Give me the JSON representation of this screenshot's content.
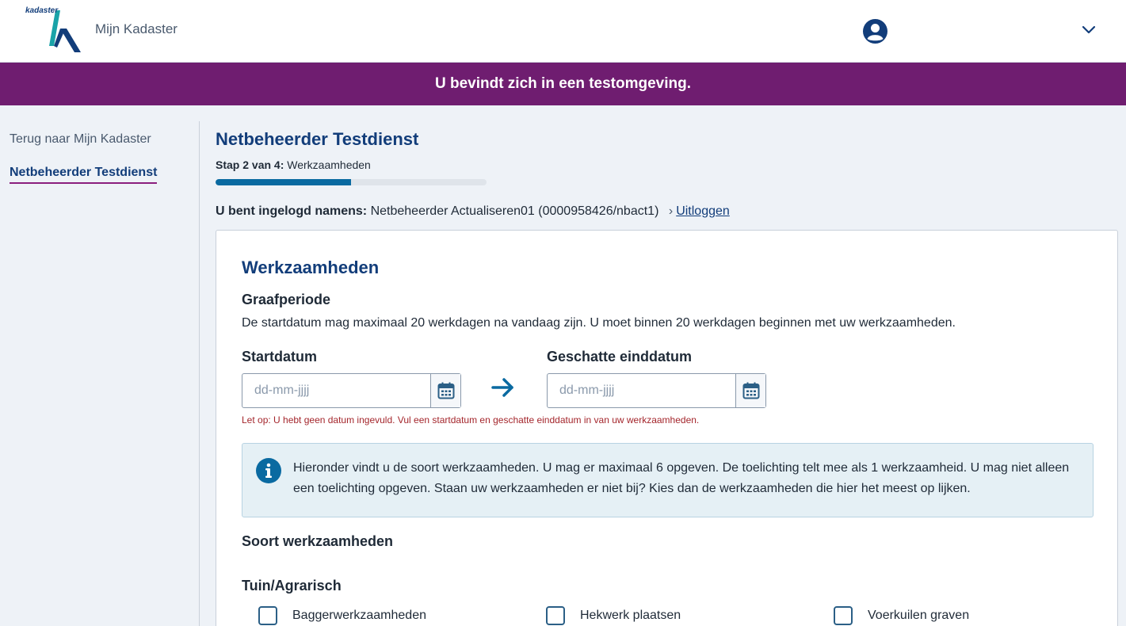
{
  "header": {
    "logo_text": "kadaster",
    "app_name": "Mijn Kadaster"
  },
  "banner": {
    "text": "U bevindt zich in een testomgeving."
  },
  "sidebar": {
    "items": [
      {
        "label": "Terug naar Mijn Kadaster"
      },
      {
        "label": "Netbeheerder Testdienst"
      }
    ]
  },
  "main": {
    "title": "Netbeheerder Testdienst",
    "step_prefix": "Stap 2 van 4:",
    "step_name": "Werkzaamheden",
    "progress_fraction": 0.5,
    "login_label": "U bent ingelogd namens:",
    "login_value": "Netbeheerder Actualiseren01 (0000958426/nbact1)",
    "logout_label": "Uitloggen"
  },
  "card": {
    "title": "Werkzaamheden",
    "graafperiode_heading": "Graafperiode",
    "graafperiode_desc": "De startdatum mag maximaal 20 werkdagen na vandaag zijn. U moet binnen 20 werkdagen beginnen met uw werkzaamheden.",
    "start_label": "Startdatum",
    "start_placeholder": "dd-mm-jjjj",
    "end_label": "Geschatte einddatum",
    "end_placeholder": "dd-mm-jjjj",
    "warning": "Let op: U hebt geen datum ingevuld. Vul een startdatum en geschatte einddatum in van uw werkzaamheden.",
    "info_text": "Hieronder vindt u de soort werkzaamheden. U mag er maximaal 6 opgeven. De toelichting telt mee als 1 werkzaamheid. U mag niet alleen een toelichting opgeven. Staan uw werkzaamheden er niet bij? Kies dan de werkzaamheden die hier het meest op lijken.",
    "soort_heading": "Soort werkzaamheden",
    "category_heading": "Tuin/Agrarisch",
    "checkboxes": [
      {
        "label": "Baggerwerkzaamheden",
        "checked": false
      },
      {
        "label": "Hekwerk plaatsen",
        "checked": false
      },
      {
        "label": "Voerkuilen graven",
        "checked": false
      }
    ]
  },
  "colors": {
    "primary": "#123d7a",
    "banner": "#6f1d70",
    "accent": "#0a6aa1",
    "warning": "#a4262c"
  },
  "icons": [
    "kadaster-logo",
    "user-icon",
    "chevron-down-icon",
    "calendar-icon",
    "arrow-right-icon",
    "info-icon"
  ]
}
